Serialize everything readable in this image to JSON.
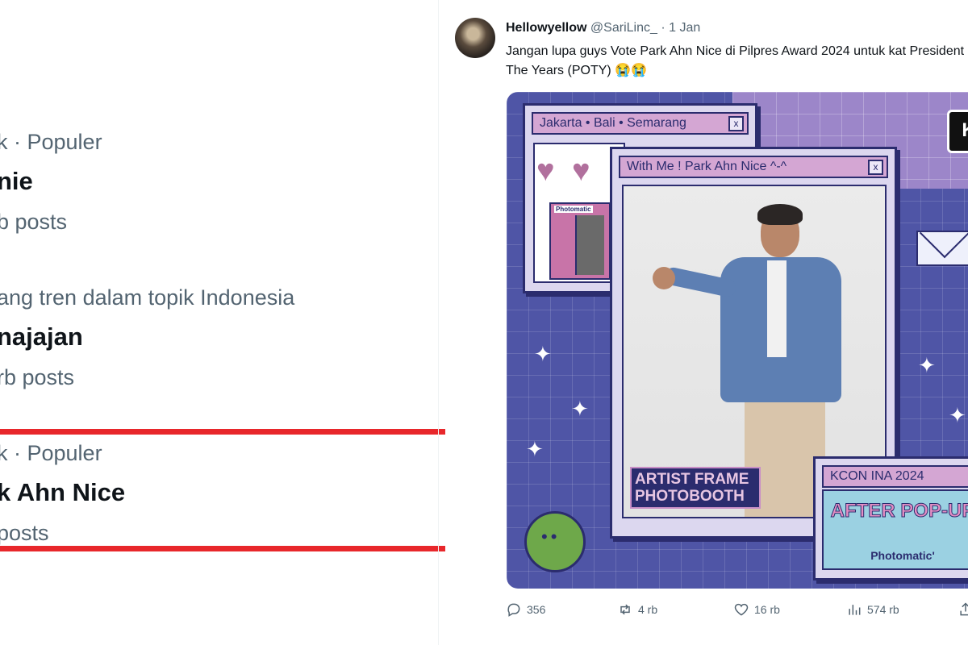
{
  "trends": [
    {
      "meta": "k · Populer",
      "name": "nie",
      "count": "b posts"
    },
    {
      "meta": "ang tren dalam topik Indonesia",
      "name": "najajan",
      "count": "rb posts"
    },
    {
      "meta": "k · Populer",
      "name": "k Ahn Nice",
      "count": "posts"
    }
  ],
  "highlight_color": "#e8272b",
  "tweet": {
    "display_name": "Hellowyellow",
    "handle": "@SariLinc_",
    "separator": "·",
    "time": "1 Jan",
    "text": "Jangan lupa guys Vote Park Ahn Nice di Pilpres Award 2024 untuk kat President Of The Years (POTY)",
    "emojis": "😭😭",
    "media": {
      "window1_title": "Jakarta • Bali • Semarang",
      "window2_title": "With Me ! Park Ahn Nice ^-^",
      "window3_title": "KCON INA 2024",
      "close_glyph": "x",
      "heart_glyph": "♥",
      "booth_label": "Photomatic",
      "artist_label": "ARTIST FRAME PHOTOBOOTH",
      "after_popup": "AFTER POP-UP",
      "brand": "Photomatic'"
    },
    "actions": {
      "replies": "356",
      "reposts": "4 rb",
      "likes": "16 rb",
      "views": "574 rb"
    }
  }
}
